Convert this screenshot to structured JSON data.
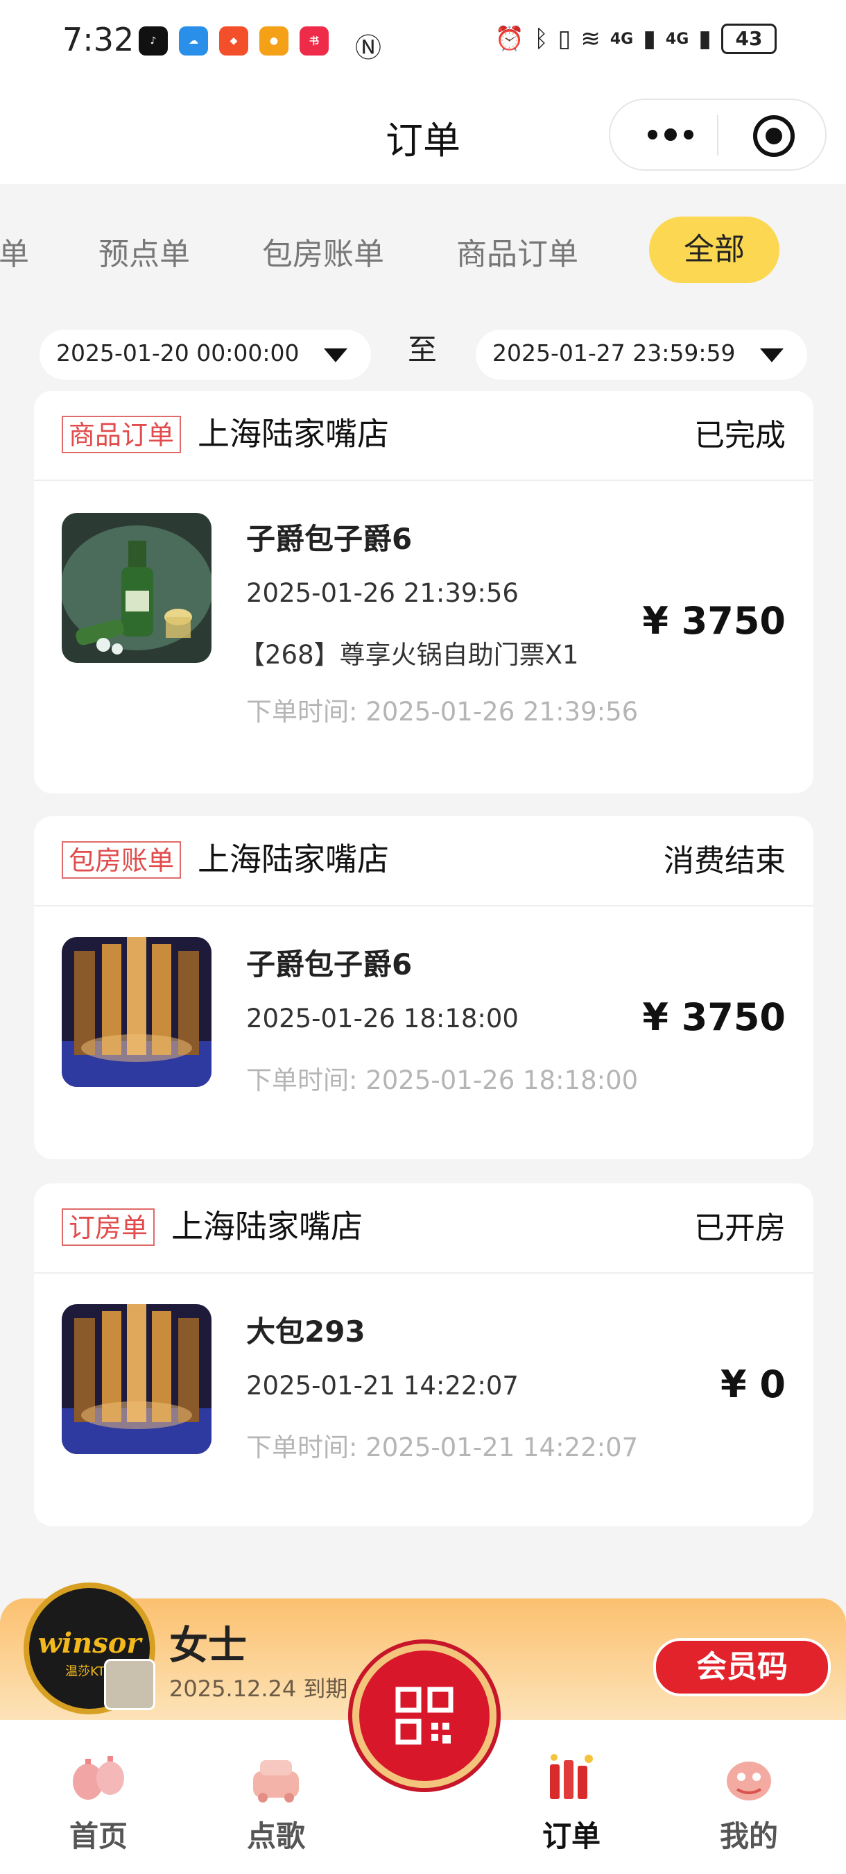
{
  "status_bar": {
    "time": "7:32",
    "network_labels": [
      "4G",
      "4G"
    ],
    "battery": "43"
  },
  "nav": {
    "title": "订单"
  },
  "tabs": {
    "items": [
      "单",
      "预点单",
      "包房账单",
      "商品订单"
    ],
    "active": "全部"
  },
  "date_filter": {
    "start": "2025-01-20 00:00:00",
    "separator": "至",
    "end": "2025-01-27 23:59:59"
  },
  "orders": [
    {
      "badge": "商品订单",
      "store": "上海陆家嘴店",
      "status": "已完成",
      "title": "子爵包子爵6",
      "time": "2025-01-26 21:39:56",
      "detail": "【268】尊享火锅自助门票X1",
      "order_time": "下单时间: 2025-01-26 21:39:56",
      "price": "¥ 3750",
      "thumb": "beer-bottle-photo"
    },
    {
      "badge": "包房账单",
      "store": "上海陆家嘴店",
      "status": "消费结束",
      "title": "子爵包子爵6",
      "time": "2025-01-26 18:18:00",
      "order_time": "下单时间: 2025-01-26 18:18:00",
      "price": "¥ 3750",
      "thumb": "ktv-room-photo"
    },
    {
      "badge": "订房单",
      "store": "上海陆家嘴店",
      "status": "已开房",
      "title": "大包293",
      "time": "2025-01-21 14:22:07",
      "order_time": "下单时间: 2025-01-21 14:22:07",
      "price": "¥ 0",
      "thumb": "ktv-room-photo"
    }
  ],
  "member": {
    "logo_text": "winsor",
    "logo_sub": "温莎KTV",
    "name": "女士",
    "expire": "2025.12.24 到期",
    "code_button": "会员码"
  },
  "tabbar": {
    "items": [
      {
        "label": "首页",
        "icon": "lantern-icon"
      },
      {
        "label": "点歌",
        "icon": "car-icon"
      },
      {
        "label": "订单",
        "icon": "firecracker-icon"
      },
      {
        "label": "我的",
        "icon": "lion-dance-icon"
      }
    ],
    "center_icon": "qr-code-icon"
  },
  "colors": {
    "accent_yellow": "#fcd852",
    "badge_red": "#e24b4b",
    "member_red": "#e2232c",
    "member_gold": "#fbc06f"
  }
}
